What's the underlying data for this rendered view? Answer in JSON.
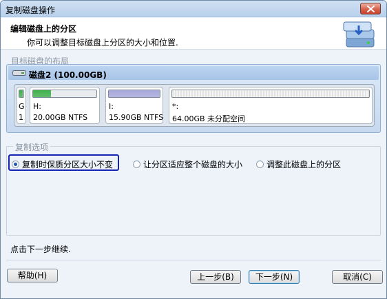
{
  "window": {
    "title": "复制磁盘操作"
  },
  "header": {
    "title": "编辑磁盘上的分区",
    "subtitle": "你可以调整目标磁盘上分区的大小和位置."
  },
  "layout_group": {
    "label": "目标磁盘的布局"
  },
  "disk": {
    "name": "磁盘2 (100.00GB)",
    "partitions": [
      {
        "label": "G",
        "detail": "1",
        "fill_fraction": 0.9,
        "fill_color": "#3fb24c"
      },
      {
        "label": "H:",
        "detail": "20.00GB NTFS",
        "fill_fraction": 0.28,
        "fill_color": "#3fb24c"
      },
      {
        "label": "I:",
        "detail": "15.90GB NTFS",
        "fill_fraction": 1.0,
        "fill_color": "#a9a9dc"
      },
      {
        "label": "*:",
        "detail": "64.00GB 未分配空间",
        "fill_fraction": 0,
        "fill_color": "#e6e6e6"
      }
    ]
  },
  "options_group": {
    "label": "复制选项",
    "options": [
      {
        "label": "复制时保质分区大小不变",
        "selected": true
      },
      {
        "label": "让分区适应整个磁盘的大小",
        "selected": false
      },
      {
        "label": "调整此磁盘上的分区",
        "selected": false
      }
    ]
  },
  "status": {
    "text": "点击下一步继续."
  },
  "buttons": {
    "help": "帮助(H)",
    "back": "上一步(B)",
    "next": "下一步(N)",
    "cancel": "取消(C)"
  },
  "colors": {
    "accent": "#1524b2",
    "panel": "#c6d9f0"
  }
}
